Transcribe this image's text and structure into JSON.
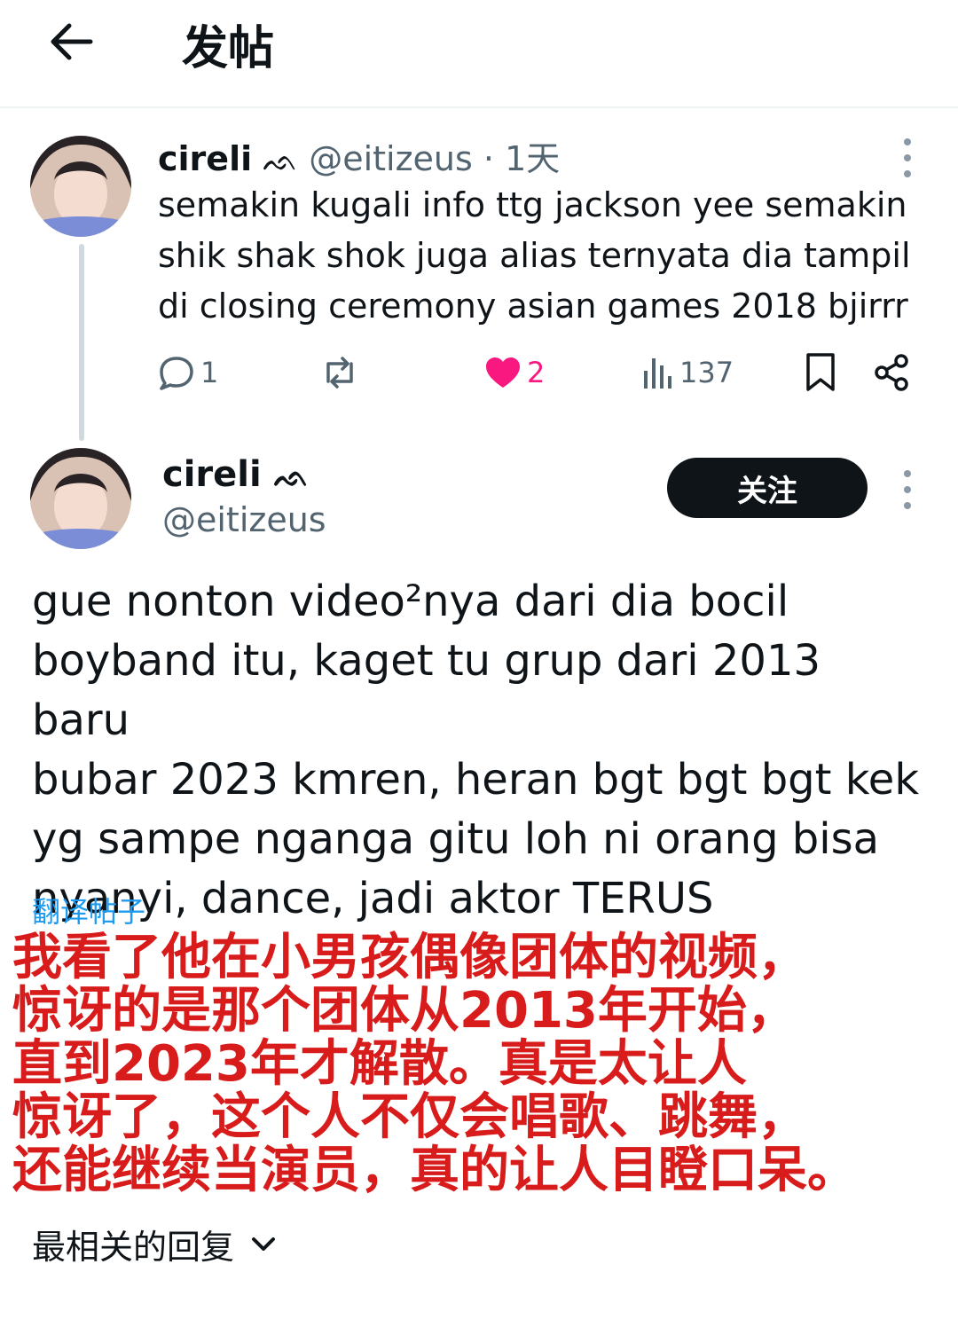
{
  "header": {
    "title": "发帖",
    "back_icon": "arrow-left-icon"
  },
  "parent_post": {
    "name": "cireli",
    "badge": "ᨒ",
    "handle": "@eitizeus",
    "separator": "·",
    "time": "1天",
    "lines": [
      "semakin kugali info ttg jackson yee semakin",
      "shik shak shok juga alias ternyata dia tampil",
      "di closing ceremony asian games 2018 bjirrr"
    ],
    "actions": {
      "reply_count": "1",
      "retweet_count": "",
      "like_count": "2",
      "view_count": "137"
    },
    "like_color": "#f91880"
  },
  "main_post": {
    "name": "cireli",
    "badge": "ᨒ",
    "handle": "@eitizeus",
    "follow_label": "关注",
    "lines": [
      "gue nonton video²nya dari dia bocil",
      "boyband itu, kaget tu grup dari 2013 baru",
      "bubar 2023 kmren, heran bgt bgt bgt kek",
      "yg sampe nganga gitu loh ni orang bisa",
      "nyanyi, dance, jadi aktor TERUS"
    ],
    "translate_label": "翻译帖子"
  },
  "overlay_caption": {
    "lines": [
      "我看了他在小男孩偶像团体的视频，",
      "惊讶的是那个团体从2013年开始，",
      "直到2023年才解散。真是太让人",
      "惊讶了，这个人不仅会唱歌、跳舞，",
      "还能继续当演员，真的让人目瞪口呆。"
    ],
    "color": "#d81b1b"
  },
  "replies": {
    "sort_label": "最相关的回复"
  },
  "colors": {
    "accent": "#1d9bf0",
    "text": "#0f1419",
    "muted": "#536471",
    "like": "#f91880"
  }
}
